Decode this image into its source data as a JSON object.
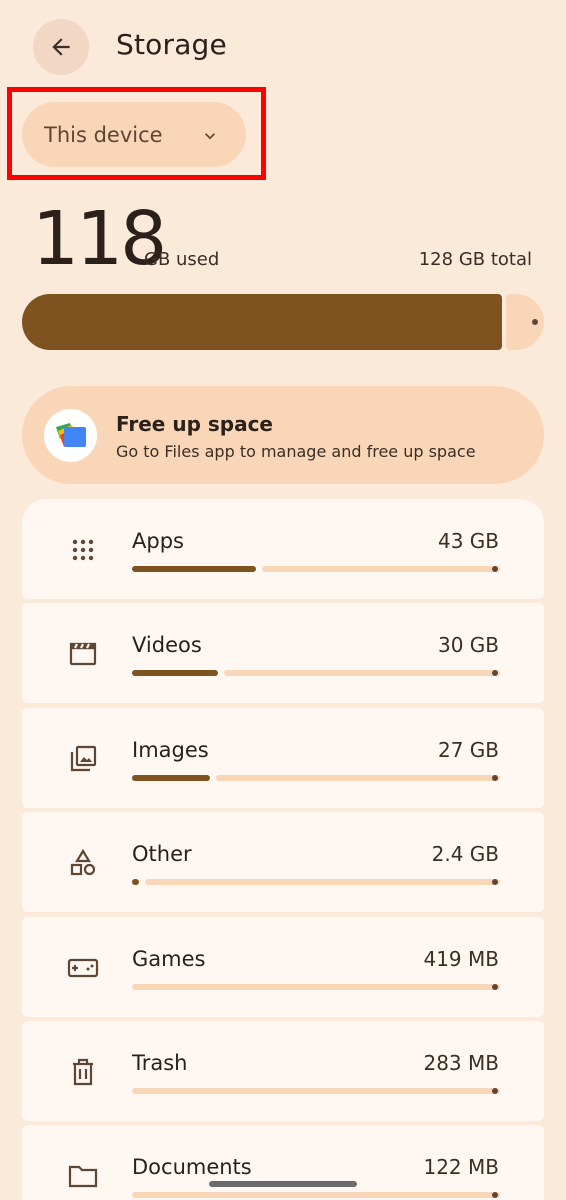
{
  "header": {
    "title": "Storage"
  },
  "device_select": {
    "label": "This device"
  },
  "summary": {
    "used_value": "118",
    "used_unit": "GB used",
    "total": "128 GB total",
    "used_fraction": 0.92
  },
  "free_up": {
    "title": "Free up space",
    "subtitle": "Go to Files app to manage and free up space"
  },
  "categories": [
    {
      "name": "Apps",
      "size": "43 GB",
      "fraction": 0.336,
      "icon": "apps-grid-icon"
    },
    {
      "name": "Videos",
      "size": "30 GB",
      "fraction": 0.234,
      "icon": "clapperboard-icon"
    },
    {
      "name": "Images",
      "size": "27 GB",
      "fraction": 0.211,
      "icon": "image-library-icon"
    },
    {
      "name": "Other",
      "size": "2.4 GB",
      "fraction": 0.019,
      "icon": "shapes-icon"
    },
    {
      "name": "Games",
      "size": "419 MB",
      "fraction": 0.0,
      "icon": "gamepad-icon"
    },
    {
      "name": "Trash",
      "size": "283 MB",
      "fraction": 0.0,
      "icon": "trash-icon"
    },
    {
      "name": "Documents",
      "size": "122 MB",
      "fraction": 0.0,
      "icon": "folder-icon"
    }
  ],
  "colors": {
    "background": "#FBE9DA",
    "accent": "#7E5320",
    "track": "#FAD6B8",
    "card": "#FFF7F2"
  }
}
